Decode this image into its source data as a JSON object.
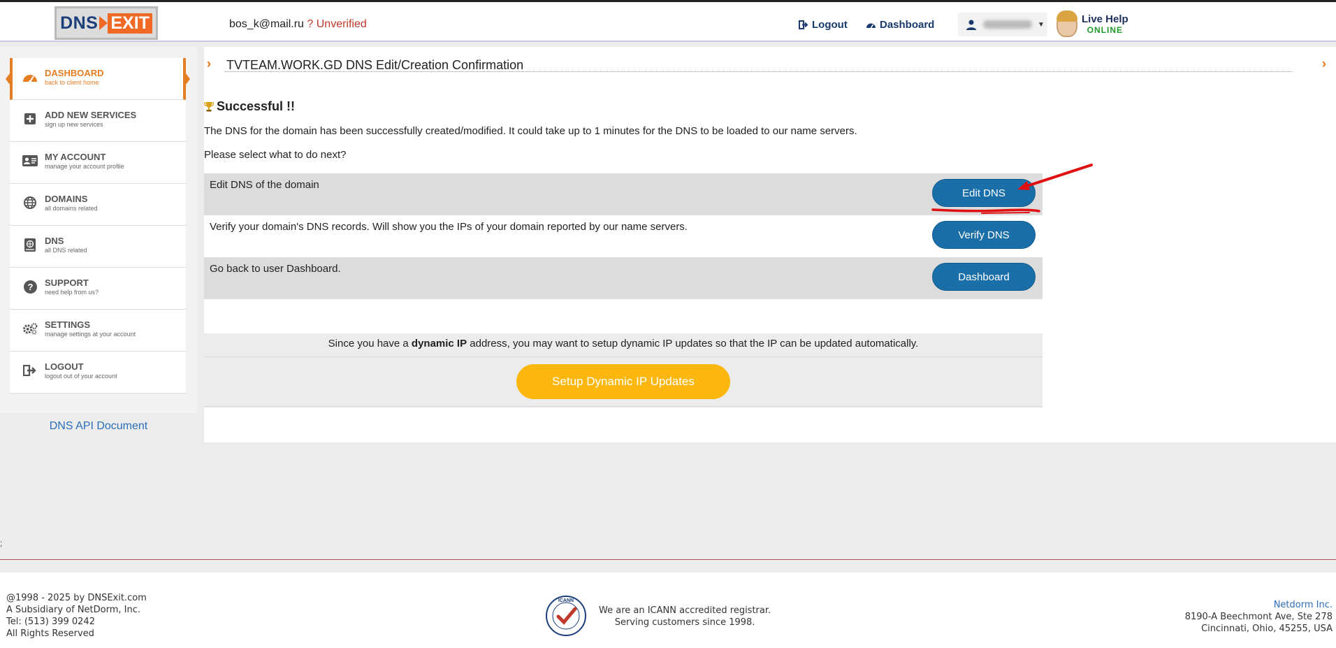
{
  "header": {
    "logo": {
      "part1": "DNS",
      "part2": "EXIT"
    },
    "user_email": "bos_k@mail.ru",
    "unverified": " ? Unverified",
    "logout_label": "Logout",
    "dashboard_label": "Dashboard",
    "live_help": {
      "title": "Live Help",
      "status": "ONLINE"
    }
  },
  "sidebar": {
    "items": [
      {
        "title": "DASHBOARD",
        "subtitle": "back to client home",
        "icon": "speedometer-icon"
      },
      {
        "title": "ADD NEW SERVICES",
        "subtitle": "sign up new services",
        "icon": "plus-square-icon"
      },
      {
        "title": "MY ACCOUNT",
        "subtitle": "manage your account profile",
        "icon": "id-card-icon"
      },
      {
        "title": "DOMAINS",
        "subtitle": "all domains related",
        "icon": "globe-icon"
      },
      {
        "title": "DNS",
        "subtitle": "all DNS related",
        "icon": "dns-book-icon"
      },
      {
        "title": "SUPPORT",
        "subtitle": "need help from us?",
        "icon": "question-circle-icon"
      },
      {
        "title": "SETTINGS",
        "subtitle": "manage settings at your account",
        "icon": "gears-icon"
      },
      {
        "title": "LOGOUT",
        "subtitle": "logout out of your account",
        "icon": "sign-out-icon"
      }
    ],
    "api_link": "DNS API Document"
  },
  "main": {
    "title": "TVTEAM.WORK.GD DNS Edit/Creation Confirmation",
    "success": "Successful !!",
    "message": "The DNS for the domain has been successfully created/modified. It could take up to 1 minutes for the DNS to be loaded to our name servers.",
    "prompt": "Please select what to do next?",
    "options": [
      {
        "label": "Edit DNS of the domain",
        "button": "Edit DNS"
      },
      {
        "label": "Verify your domain's DNS records. Will show you the IPs of your domain reported by our name servers.",
        "button": "Verify DNS"
      },
      {
        "label": "Go back to user Dashboard.",
        "button": "Dashboard"
      }
    ],
    "dynamic": {
      "before": "Since you have a ",
      "bold": "dynamic IP",
      "after": " address, you may want to setup dynamic IP updates so that the IP can be updated automatically.",
      "button": "Setup Dynamic IP Updates"
    }
  },
  "stray": ";",
  "footer": {
    "left": [
      "@1998 - 2025 by DNSExit.com",
      "A Subsidiary of NetDorm, Inc.",
      "Tel: (513) 399 0242",
      "All Rights Reserved"
    ],
    "icann": [
      "We are an ICANN accredited registrar.",
      "Serving customers since 1998."
    ],
    "right": {
      "company": "Netdorm Inc.",
      "address1": "8190-A Beechmont Ave, Ste 278",
      "address2": "Cincinnati, Ohio, 45255, USA"
    }
  },
  "colors": {
    "accent": "#e57d22",
    "button_blue": "#1a6fa8",
    "button_yellow": "#fbb70e",
    "link": "#2a6db8",
    "annotation_red": "#e01010"
  }
}
